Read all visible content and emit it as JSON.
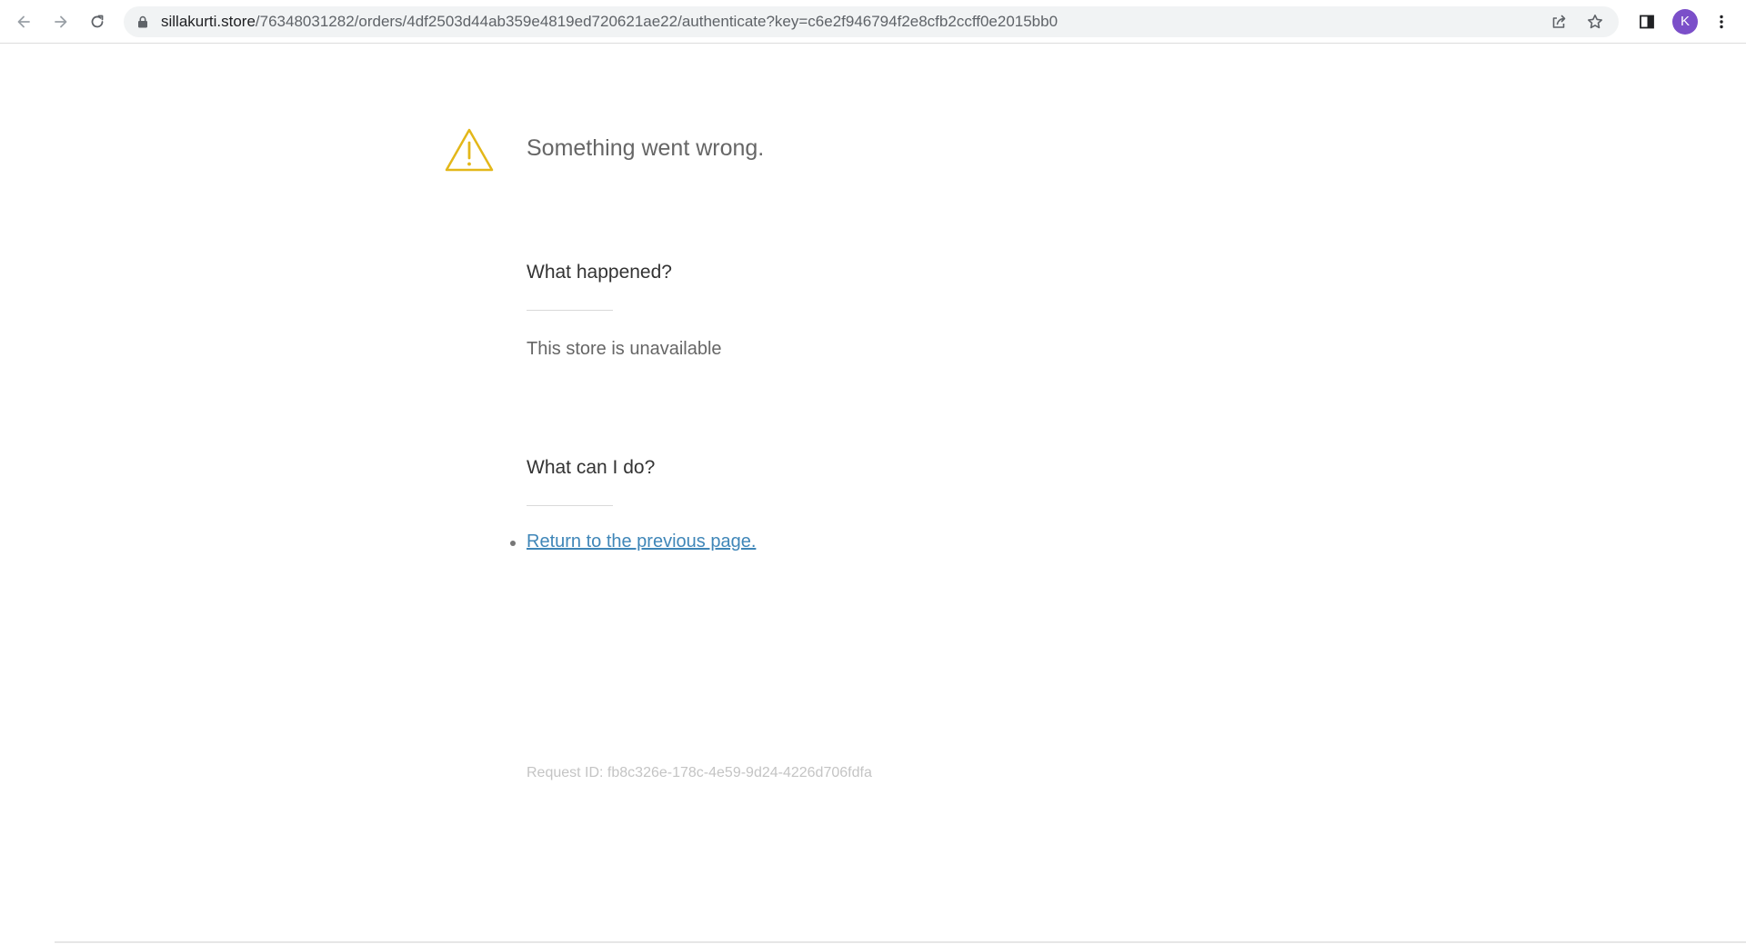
{
  "browser": {
    "url_host": "sillakurti.store",
    "url_path": "/76348031282/orders/4df2503d44ab359e4819ed720621ae22/authenticate?key=c6e2f946794f2e8cfb2ccff0e2015bb0",
    "profile_initial": "K",
    "profile_color": "#7b4fc9",
    "icons": {
      "back": "arrow-left-icon",
      "forward": "arrow-right-icon",
      "reload": "reload-icon",
      "lock": "lock-icon",
      "share": "share-icon",
      "bookmark": "star-icon",
      "side_panel": "side-panel-icon",
      "menu": "kebab-menu-icon"
    }
  },
  "error_page": {
    "title": "Something went wrong.",
    "warning_color": "#e3b719",
    "what_happened": {
      "heading": "What happened?",
      "message": "This store is unavailable"
    },
    "what_can_i_do": {
      "heading": "What can I do?",
      "actions": [
        {
          "label": "Return to the previous page."
        }
      ]
    },
    "request_id": "Request ID: fb8c326e-178c-4e59-9d24-4226d706fdfa",
    "link_color": "#3f86b8"
  }
}
